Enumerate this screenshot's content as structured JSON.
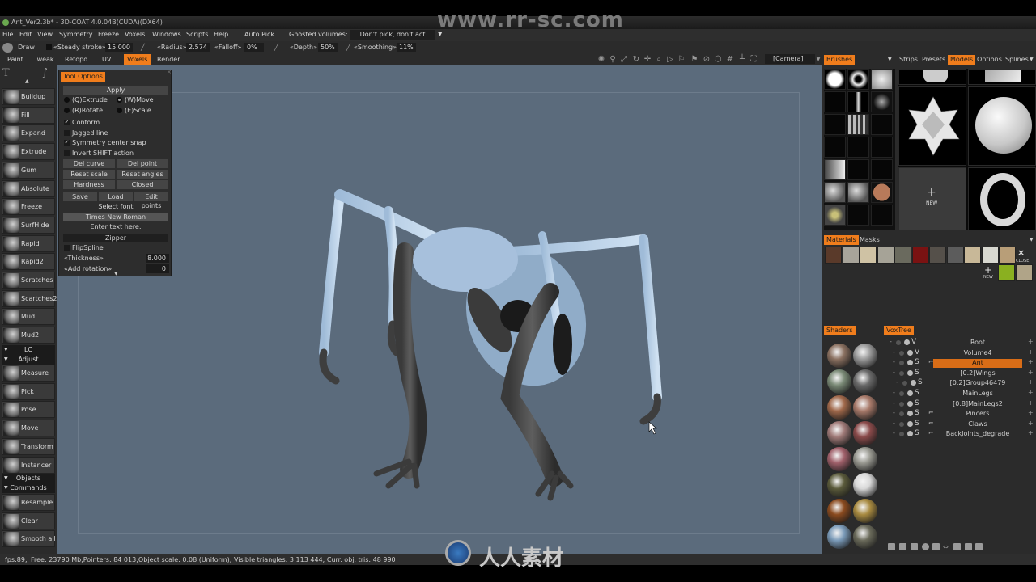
{
  "window": {
    "title": "Ant_Ver2.3b* - 3D-COAT 4.0.04B(CUDA)(DX64)",
    "watermark_url": "www.rr-sc.com",
    "watermark_logo_text": "人人素材"
  },
  "menubar": {
    "items": [
      "File",
      "Edit",
      "View",
      "Symmetry",
      "Freeze",
      "Voxels",
      "Windows",
      "Scripts",
      "Help"
    ],
    "auto_pick_label": "Auto Pick",
    "ghosted_label": "Ghosted volumes:",
    "ghosted_value": "Don't pick, don't act"
  },
  "paramsbar": {
    "tool_label": "Draw",
    "steady_stroke_label": "«Steady stroke»",
    "steady_stroke_value": "15.000",
    "radius_label": "«Radius»",
    "radius_value": "2.574",
    "falloff_label": "«Falloff»",
    "falloff_value": "0%",
    "depth_label": "«Depth»",
    "depth_value": "50%",
    "smoothing_label": "«Smoothing»",
    "smoothing_value": "11%"
  },
  "rooms": {
    "tabs": [
      "Paint",
      "Tweak",
      "Retopo",
      "UV",
      "Voxels",
      "Render"
    ],
    "active": "Voxels",
    "camera_select": "[Camera]"
  },
  "right_tabs": {
    "brushes": "Brushes",
    "strips": "Strips",
    "presets": "Presets",
    "models": "Models",
    "options": "Options",
    "splines": "Splines",
    "materials": "Materials",
    "masks": "Masks",
    "shaders": "Shaders",
    "voxtree": "VoxTree",
    "new_label": "NEW",
    "close_label": "CLOSE"
  },
  "tools": {
    "voxel_tools": [
      "Buildup",
      "Fill",
      "Expand",
      "Extrude",
      "Gum",
      "Absolute",
      "Freeze",
      "SurfHide",
      "Rapid",
      "Rapid2",
      "Scratches",
      "Scartches2",
      "Mud",
      "Mud2"
    ],
    "section_lc": "LC",
    "section_adjust": "Adjust",
    "adjust_tools": [
      "Measure",
      "Pick",
      "Pose",
      "Move",
      "Transform",
      "Instancer"
    ],
    "section_objects": "Objects",
    "section_commands": "Commands",
    "command_tools": [
      "Resample",
      "Clear",
      "Smooth all"
    ]
  },
  "tool_options": {
    "tab": "Tool Options",
    "apply": "Apply",
    "radios": [
      {
        "label": "(Q)Extrude",
        "selected": false
      },
      {
        "label": "(W)Move",
        "selected": true
      },
      {
        "label": "(R)Rotate",
        "selected": false
      },
      {
        "label": "(E)Scale",
        "selected": false
      }
    ],
    "checks": [
      {
        "label": "Conform",
        "checked": true
      },
      {
        "label": "Jagged line",
        "checked": false
      },
      {
        "label": "Symmetry center snap",
        "checked": true
      },
      {
        "label": "Invert SHIFT action",
        "checked": false
      }
    ],
    "del_curve": "Del curve",
    "del_point": "Del point",
    "reset_scale": "Reset scale",
    "reset_angles": "Reset angles",
    "hardness": "Hardness",
    "closed": "Closed",
    "save": "Save",
    "load": "Load",
    "edit_points": "Edit points",
    "select_font": "Select font",
    "font_value": "Times New Roman",
    "enter_text": "Enter text here:",
    "text_value": "Zipper",
    "flip_spline": "FlipSpline",
    "flip_spline_checked": false,
    "thickness_label": "«Thickness»",
    "thickness_value": "8.000",
    "add_rotation_label": "«Add rotation»",
    "add_rotation_value": "0"
  },
  "voxtree": {
    "rows": [
      {
        "indent": 0,
        "type": "V",
        "name": "Root",
        "selected": false,
        "chain": false
      },
      {
        "indent": 1,
        "type": "V",
        "name": "Volume4",
        "selected": false,
        "chain": false
      },
      {
        "indent": 1,
        "type": "S",
        "name": "Ant",
        "selected": true,
        "chain": true
      },
      {
        "indent": 1,
        "type": "S",
        "name": "[0.2]Wings",
        "selected": false,
        "chain": false
      },
      {
        "indent": 2,
        "type": "S",
        "name": "[0.2]Group46479",
        "selected": false,
        "chain": false
      },
      {
        "indent": 1,
        "type": "S",
        "name": "MainLegs",
        "selected": false,
        "chain": false
      },
      {
        "indent": 1,
        "type": "S",
        "name": "[0.8]MainLegs2",
        "selected": false,
        "chain": false
      },
      {
        "indent": 1,
        "type": "S",
        "name": "Pincers",
        "selected": false,
        "chain": true
      },
      {
        "indent": 1,
        "type": "S",
        "name": "Claws",
        "selected": false,
        "chain": true
      },
      {
        "indent": 1,
        "type": "S",
        "name": "BackJoints_degrade",
        "selected": false,
        "chain": true
      }
    ]
  },
  "materials": {
    "colors": [
      "#5a3a2a",
      "#a8a49a",
      "#cfc2a4",
      "#a6a397",
      "#6a6a5e",
      "#7a1212",
      "#55504a",
      "#5c5c5c",
      "#c8b898",
      "#d8d8d0",
      "#b89e78"
    ],
    "row2_colors": [
      "#8ab020",
      "#b0a488"
    ]
  },
  "shaders": {
    "colors": [
      "#8a7060",
      "#9a9a9a",
      "#7a8a76",
      "#6a6a6a",
      "#a0684a",
      "#a87a6a",
      "#a07a78",
      "#8a4a4a",
      "#a0606a",
      "#9a9a92",
      "#5a5a3a",
      "#d8d8d8",
      "#8a4a1e",
      "#a88a40",
      "#7a9ab8",
      "#6a6a5a"
    ]
  },
  "status": {
    "fps": "fps:89;",
    "info": "Free: 23790 Mb,Pointers: 84 013;Object scale: 0.08 (Uniform); Visible triangles: 3 113 444; Curr. obj. tris: 48 990"
  },
  "colors": {
    "accent": "#f07d1c",
    "viewport_bg": "#5b6b7c",
    "panel_bg": "#2b2b2b"
  }
}
